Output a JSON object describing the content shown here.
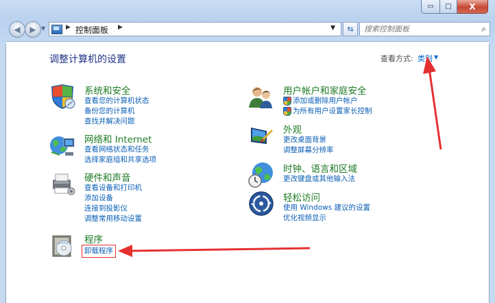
{
  "window": {
    "caption_buttons": [
      {
        "name": "minimize",
        "glyph": "▭"
      },
      {
        "name": "maximize",
        "glyph": "□"
      },
      {
        "name": "close",
        "glyph": "X"
      }
    ]
  },
  "navbar": {
    "back_icon": "◀",
    "forward_icon": "▶",
    "breadcrumb": [
      "控制面板"
    ],
    "breadcrumb_sep": "▶",
    "address_dropdown": "▼",
    "refresh_glyph": "⇆",
    "search_placeholder": "搜索控制面板",
    "search_icon": "⌕"
  },
  "header": {
    "title": "调整计算机的设置",
    "view_by_label": "查看方式:",
    "view_by_value": "类别",
    "view_dropdown": "▼"
  },
  "categories_left": [
    {
      "id": "system-security",
      "icon": "shield-icon",
      "title": "系统和安全",
      "links": [
        "查看您的计算机状态",
        "备份您的计算机",
        "查找并解决问题"
      ]
    },
    {
      "id": "network-internet",
      "icon": "network-globe-icon",
      "title": "网络和 Internet",
      "links": [
        "查看网络状态和任务",
        "选择家庭组和共享选项"
      ]
    },
    {
      "id": "hardware-sound",
      "icon": "printer-icon",
      "title": "硬件和声音",
      "links": [
        "查看设备和打印机",
        "添加设备",
        "连接到投影仪",
        "调整常用移动设置"
      ]
    },
    {
      "id": "programs",
      "icon": "programs-disc-icon",
      "title": "程序",
      "links": [
        "卸载程序"
      ]
    }
  ],
  "categories_right": [
    {
      "id": "user-accounts",
      "icon": "users-icon",
      "title": "用户帐户和家庭安全",
      "links": [
        "添加或删除用户帐户",
        "为所有用户设置家长控制"
      ]
    },
    {
      "id": "appearance",
      "icon": "appearance-monitor-icon",
      "title": "外观",
      "links": [
        "更改桌面背景",
        "调整屏幕分辨率"
      ]
    },
    {
      "id": "clock-region",
      "icon": "clock-globe-icon",
      "title": "时钟、语言和区域",
      "links": [
        "更改键盘或其他输入法"
      ]
    },
    {
      "id": "ease-of-access",
      "icon": "accessibility-icon",
      "title": "轻松访问",
      "links": [
        "使用 Windows 建议的设置",
        "优化视频显示"
      ]
    }
  ],
  "colors": {
    "category_title": "#1e7a24",
    "link": "#0b5fb6",
    "page_title": "#1e3287",
    "annotation_red": "#e53030"
  }
}
